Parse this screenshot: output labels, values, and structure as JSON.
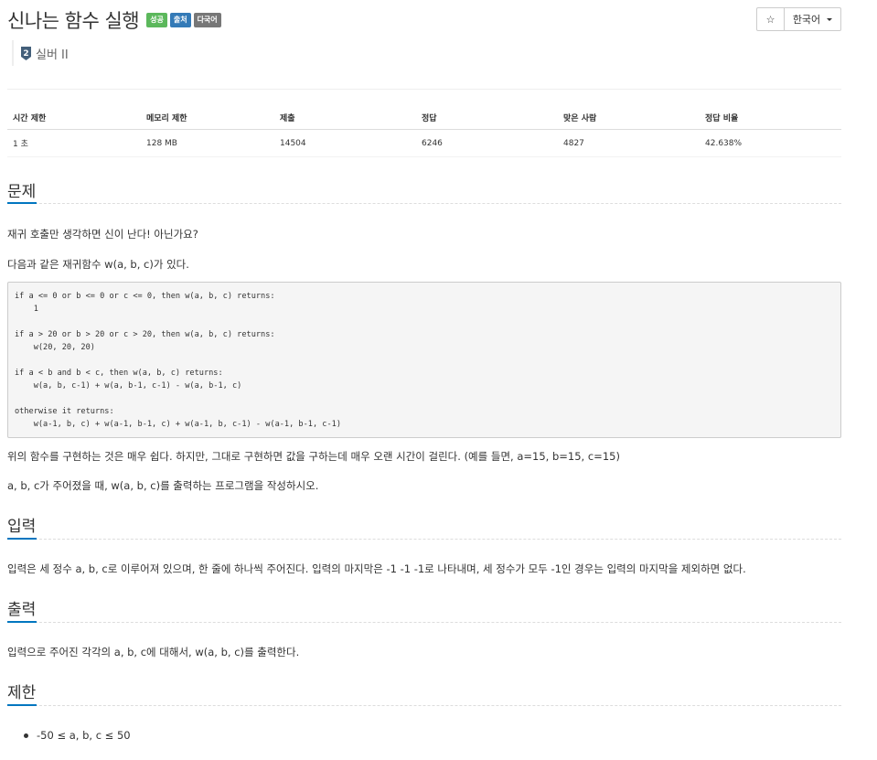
{
  "header": {
    "title": "신나는 함수 실행",
    "badges": [
      {
        "label": "성공",
        "color": "#5cb85c"
      },
      {
        "label": "출처",
        "color": "#337ab7"
      },
      {
        "label": "다국어",
        "color": "#777777"
      }
    ],
    "star_glyph": "☆",
    "language": "한국어"
  },
  "tier": {
    "badge_number": "2",
    "label": "실버 II",
    "icon": "silver-tier-icon"
  },
  "stats": {
    "headers": [
      "시간 제한",
      "메모리 제한",
      "제출",
      "정답",
      "맞은 사람",
      "정답 비율"
    ],
    "values": [
      "1 초",
      "128 MB",
      "14504",
      "6246",
      "4827",
      "42.638%"
    ]
  },
  "problem": {
    "title": "문제",
    "intro1": "재귀 호출만 생각하면 신이 난다! 아닌가요?",
    "intro2": "다음과 같은 재귀함수 w(a, b, c)가 있다.",
    "code": "if a <= 0 or b <= 0 or c <= 0, then w(a, b, c) returns:\n    1\n\nif a > 20 or b > 20 or c > 20, then w(a, b, c) returns:\n    w(20, 20, 20)\n\nif a < b and b < c, then w(a, b, c) returns:\n    w(a, b, c-1) + w(a, b-1, c-1) - w(a, b-1, c)\n\notherwise it returns:\n    w(a-1, b, c) + w(a-1, b-1, c) + w(a-1, b, c-1) - w(a-1, b-1, c-1)",
    "after1": "위의 함수를 구현하는 것은 매우 쉽다. 하지만, 그대로 구현하면 값을 구하는데 매우 오랜 시간이 걸린다. (예를 들면, a=15, b=15, c=15)",
    "after2": "a, b, c가 주어졌을 때, w(a, b, c)를 출력하는 프로그램을 작성하시오."
  },
  "input": {
    "title": "입력",
    "text": "입력은 세 정수 a, b, c로 이루어져 있으며, 한 줄에 하나씩 주어진다. 입력의 마지막은 -1 -1 -1로 나타내며, 세 정수가 모두 -1인 경우는 입력의 마지막을 제외하면 없다."
  },
  "output": {
    "title": "출력",
    "text": "입력으로 주어진 각각의 a, b, c에 대해서, w(a, b, c)를 출력한다."
  },
  "limits": {
    "title": "제한",
    "items": [
      "-50 ≤ a, b, c ≤ 50"
    ]
  },
  "colors": {
    "accent": "#0076c0",
    "code_bg": "#f5f5f5"
  }
}
